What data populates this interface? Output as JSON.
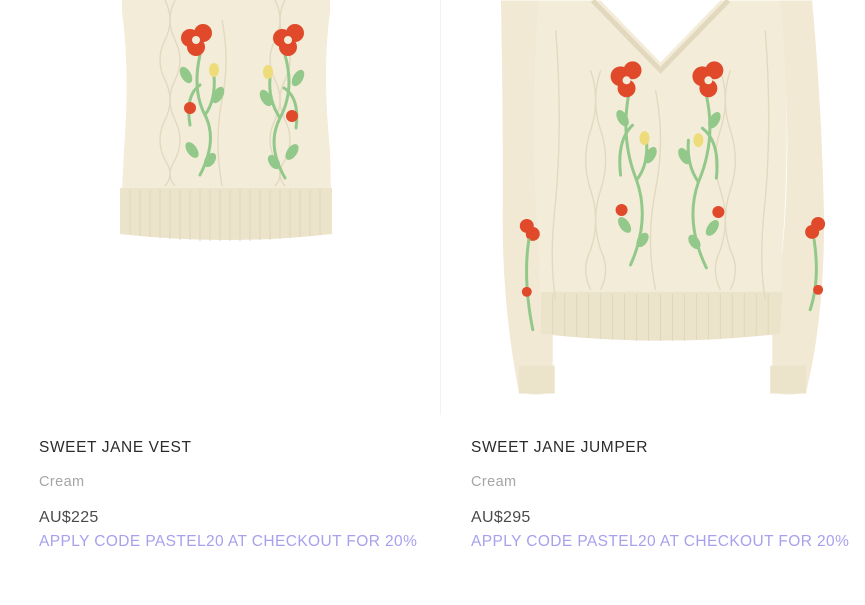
{
  "products": [
    {
      "name": "SWEET JANE VEST",
      "color": "Cream",
      "price": "AU$225",
      "promo": "APPLY CODE PASTEL20 AT CHECKOUT FOR 20%",
      "image": "cream-cable-knit-vest-with-embroidered-flowers"
    },
    {
      "name": "SWEET JANE JUMPER",
      "color": "Cream",
      "price": "AU$295",
      "promo": "APPLY CODE PASTEL20 AT CHECKOUT FOR 20%",
      "image": "cream-cable-knit-jumper-with-embroidered-flowers"
    }
  ],
  "colors": {
    "knit": "#f3ecd9",
    "knit_shadow": "#e5dcc4",
    "flower_red": "#e04a2a",
    "flower_yellow": "#eedc7a",
    "stem_green": "#92c98a",
    "promo": "#a7a0ee",
    "title": "#2b2b2b",
    "subdued": "#a6a6a6"
  }
}
